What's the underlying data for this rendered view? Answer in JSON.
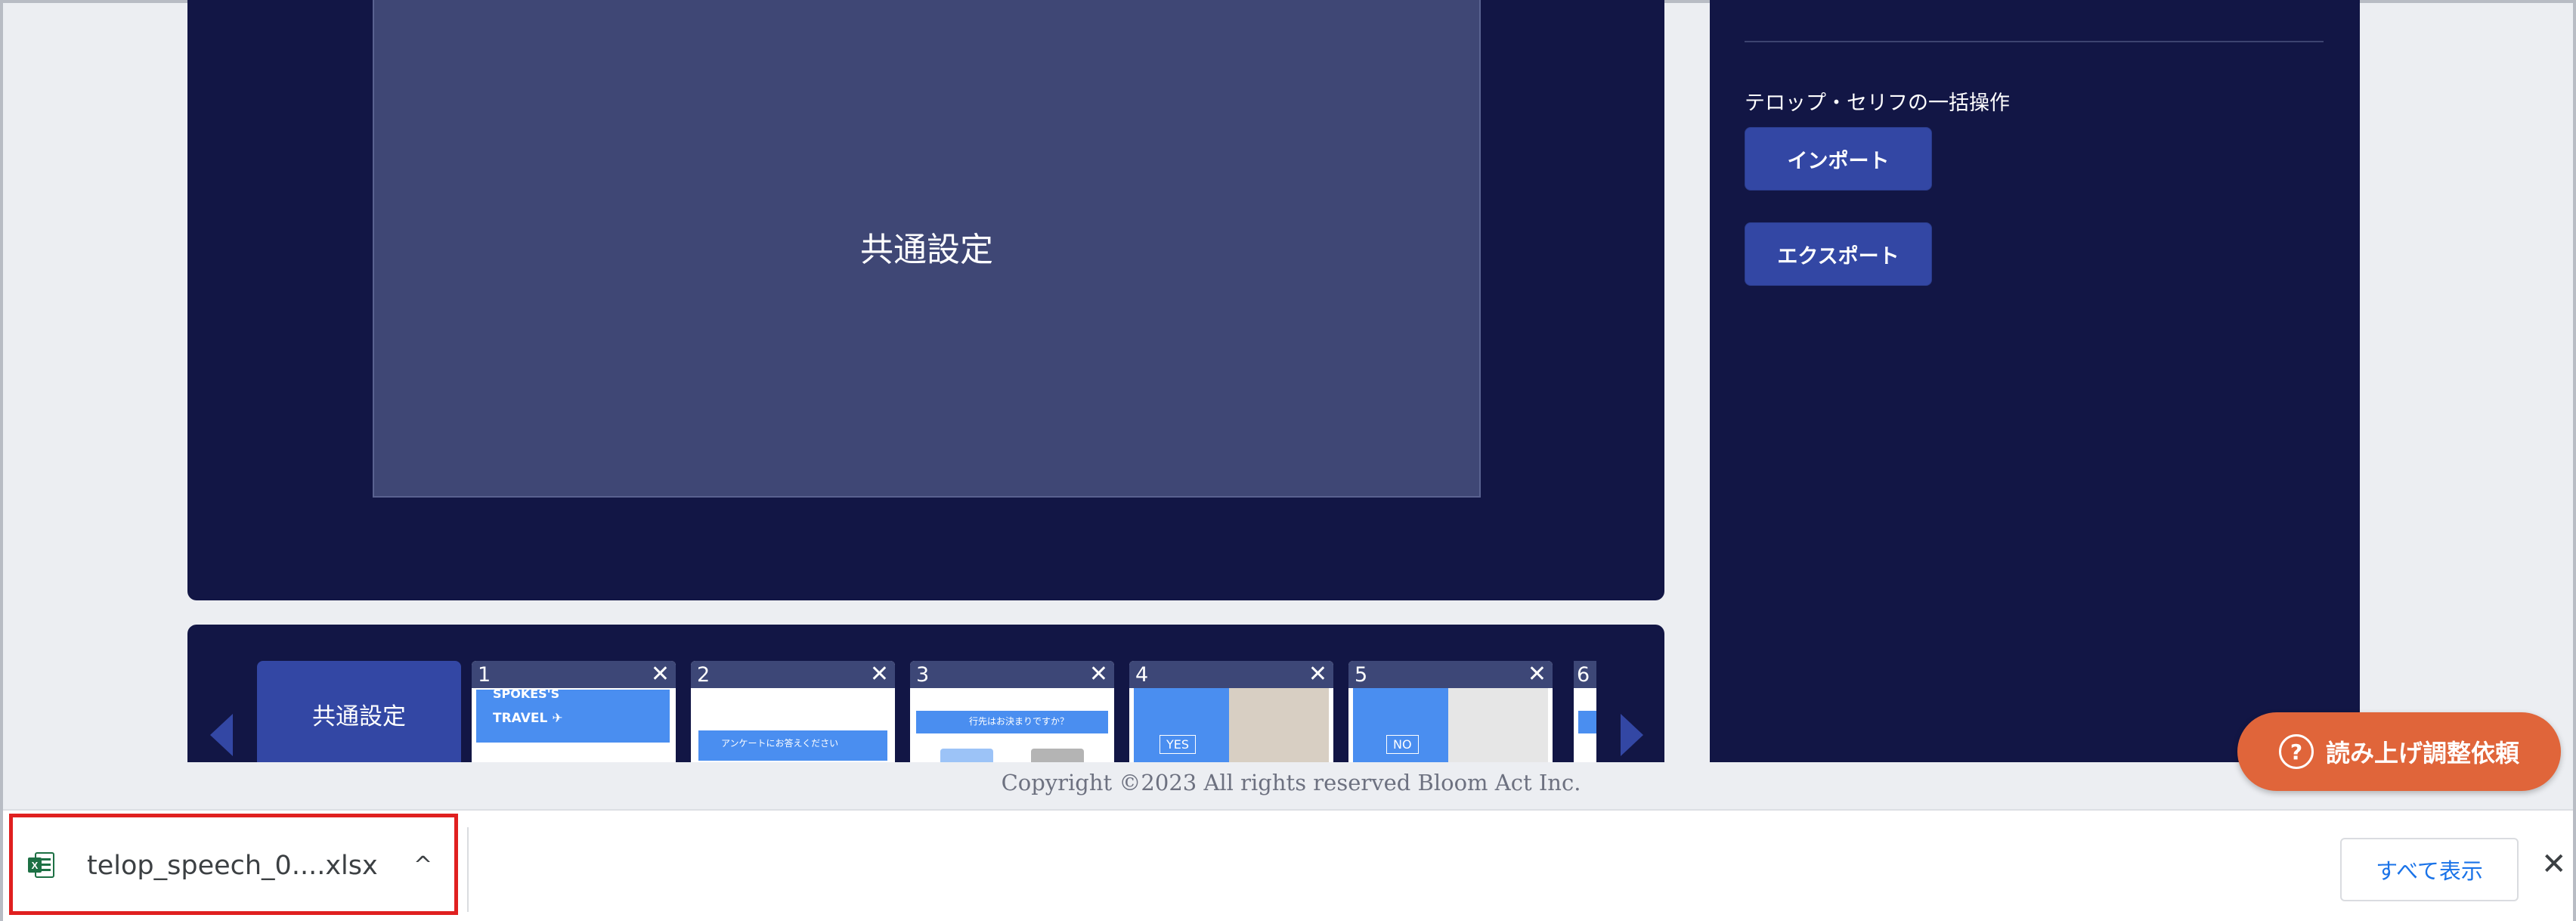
{
  "preview": {
    "label": "共通設定"
  },
  "panel": {
    "heading": "テロップ・セリフの一括操作",
    "import_label": "インポート",
    "export_label": "エクスポート"
  },
  "strip": {
    "common_label": "共通設定",
    "slides": [
      {
        "number": "1",
        "close": "✕",
        "title_line1": "SPOKES'S",
        "title_line2": "TRAVEL ✈"
      },
      {
        "number": "2",
        "close": "✕",
        "caption": "アンケートにお答えください"
      },
      {
        "number": "3",
        "close": "✕",
        "caption": "行先はお決まりですか？"
      },
      {
        "number": "4",
        "close": "✕",
        "caption": "YES"
      },
      {
        "number": "5",
        "close": "✕",
        "caption": "NO"
      },
      {
        "number": "6"
      }
    ]
  },
  "footer": {
    "copyright": "Copyright ©2023 All rights reserved Bloom Act Inc."
  },
  "help_button": {
    "label": "読み上げ調整依頼",
    "icon": "?"
  },
  "download_bar": {
    "file_name": "telop_speech_0....xlsx",
    "show_all": "すべて表示",
    "close": "✕",
    "chevron": "^"
  },
  "colors": {
    "stage_bg": "#121645",
    "button_bg": "#3347a4",
    "help_button_bg": "#e0653a",
    "highlight_border": "#e02020",
    "link_blue": "#1a73e8"
  }
}
